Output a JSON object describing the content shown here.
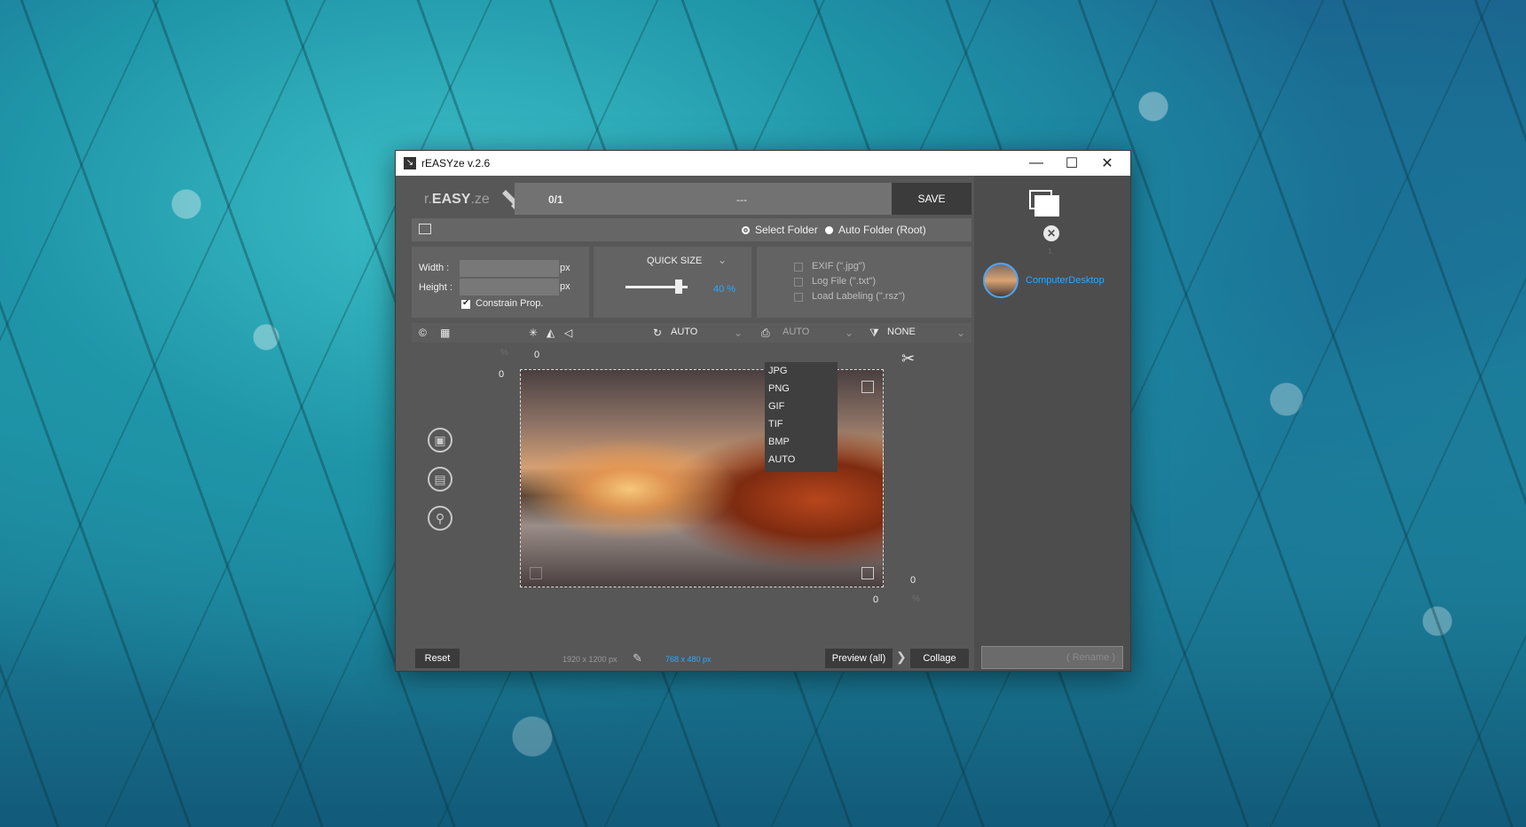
{
  "window": {
    "title": "rEASYze v.2.6",
    "controls": {
      "minimize": "—",
      "maximize": "☐",
      "close": "✕"
    }
  },
  "logo": {
    "prefix": "r.",
    "brand": "EASY",
    "suffix": ".ze"
  },
  "progress": {
    "count": "0/1",
    "status": "---"
  },
  "save_label": "SAVE",
  "folder": {
    "select_folder": "Select Folder",
    "auto_folder": "Auto Folder (Root)"
  },
  "size": {
    "width_label": "Width :",
    "height_label": "Height :",
    "unit": "px",
    "constrain_label": "Constrain Prop.",
    "constrain_checked": true
  },
  "quick_size": {
    "label": "QUICK SIZE",
    "percent": "40 %",
    "level": 0.4
  },
  "options": [
    {
      "label": "EXIF (\".jpg\")",
      "checked": false
    },
    {
      "label": "Log File (\".txt\")",
      "checked": false
    },
    {
      "label": "Load Labeling (\".rsz\")",
      "checked": false
    }
  ],
  "toolbar": {
    "rotate_value": "AUTO",
    "format_value": "AUTO",
    "filter_value": "NONE"
  },
  "format_menu": [
    "JPG",
    "PNG",
    "GIF",
    "TIF",
    "BMP",
    "AUTO"
  ],
  "canvas": {
    "top_coord": "0",
    "left_coord": "0",
    "bottom_right_x": "0",
    "bottom_right_y": "0",
    "pct": "%"
  },
  "bottom": {
    "reset_label": "Reset",
    "original_dims": "1920 x 1200 px",
    "target_dims": "768 x 480 px",
    "preview_label": "Preview (all)",
    "collage_label": "Collage"
  },
  "right_panel": {
    "count": "1",
    "file_name": "ComputerDesktop",
    "rename_label": "( Rename )"
  },
  "colors": {
    "accent": "#2aa8ff",
    "panel": "#636363",
    "dark_button": "#3b3b3b"
  }
}
